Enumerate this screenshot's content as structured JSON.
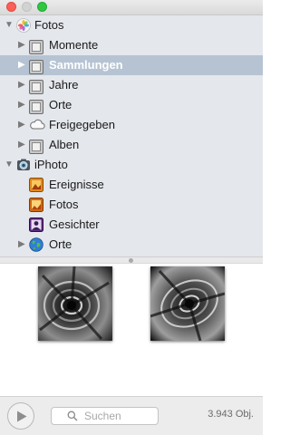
{
  "sidebar": {
    "fotos": {
      "label": "Fotos",
      "children": [
        {
          "label": "Momente"
        },
        {
          "label": "Sammlungen"
        },
        {
          "label": "Jahre"
        },
        {
          "label": "Orte"
        },
        {
          "label": "Freigegeben"
        },
        {
          "label": "Alben"
        }
      ]
    },
    "iphoto": {
      "label": "iPhoto",
      "children": [
        {
          "label": "Ereignisse"
        },
        {
          "label": "Fotos"
        },
        {
          "label": "Gesichter"
        },
        {
          "label": "Orte"
        }
      ]
    },
    "selected": "Sammlungen"
  },
  "search": {
    "placeholder": "Suchen"
  },
  "status": {
    "count": "3.943 Obj."
  },
  "colors": {
    "selection": "#b6c3d3",
    "sidebar_bg": "#e4e7ec"
  }
}
